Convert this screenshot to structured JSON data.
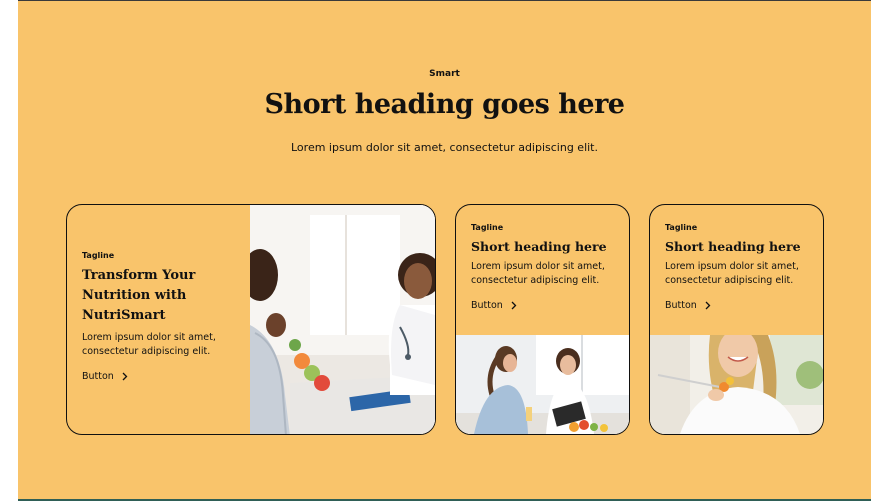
{
  "header": {
    "eyebrow": "Smart",
    "heading": "Short heading goes here",
    "description": "Lorem ipsum dolor sit amet, consectetur adipiscing elit."
  },
  "cards": [
    {
      "tagline": "Tagline",
      "title": "Transform Your Nutrition with NutriSmart",
      "description": "Lorem ipsum dolor sit amet, consectetur adipiscing elit.",
      "button_label": "Button",
      "icon": "chevron-right-icon"
    },
    {
      "tagline": "Tagline",
      "title": "Short heading here",
      "description": "Lorem ipsum dolor sit amet, consectetur adipiscing elit.",
      "button_label": "Button",
      "icon": "chevron-right-icon"
    },
    {
      "tagline": "Tagline",
      "title": "Short heading here",
      "description": "Lorem ipsum dolor sit amet, consectetur adipiscing elit.",
      "button_label": "Button",
      "icon": "chevron-right-icon"
    }
  ],
  "colors": {
    "section_background": "#f9c46b",
    "text": "#111111",
    "card_border": "#111111"
  }
}
